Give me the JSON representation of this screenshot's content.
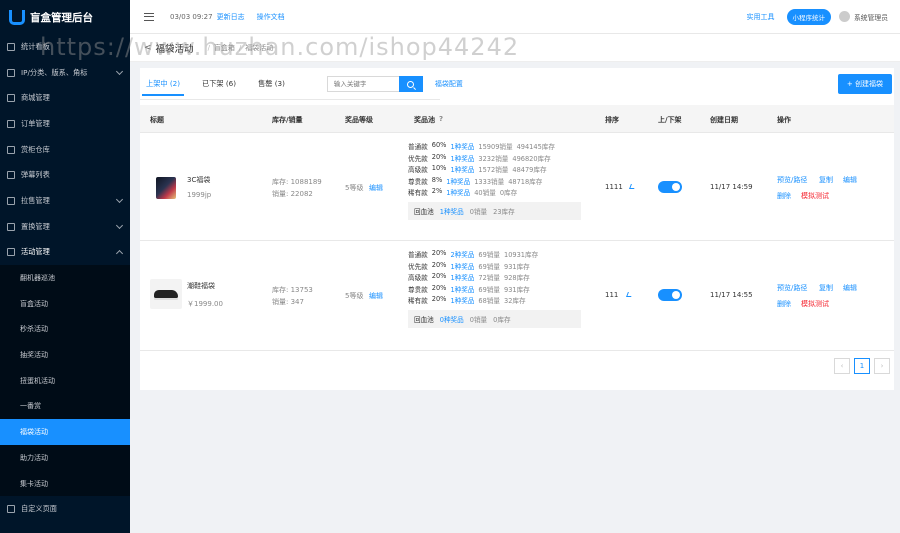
{
  "app": {
    "title": "盲盒管理后台"
  },
  "sidebar": {
    "items": [
      {
        "label": "统计看板",
        "chevron": false
      },
      {
        "label": "IP/分类、版系、角标",
        "chevron": true
      },
      {
        "label": "商城管理",
        "chevron": false
      },
      {
        "label": "订单管理",
        "chevron": false
      },
      {
        "label": "赏柜仓库",
        "chevron": false
      },
      {
        "label": "弹幕列表",
        "chevron": false
      },
      {
        "label": "拉售管理",
        "chevron": true
      },
      {
        "label": "置换管理",
        "chevron": true
      }
    ],
    "open_group": {
      "label": "活动管理"
    },
    "sub_items": [
      "翻机器巡池",
      "盲盒活动",
      "秒杀活动",
      "抽奖活动",
      "扭蛋机活动",
      "一番赏",
      "福袋活动",
      "助力活动",
      "集卡活动"
    ],
    "active_sub": "福袋活动",
    "footer_item": {
      "label": "自定义页面"
    }
  },
  "header": {
    "date": "03/03 09:27",
    "changelog": "更新日志",
    "docs": "操作文档",
    "tools": "实用工具",
    "mini_stats": "小程序统计",
    "user": "系统管理员"
  },
  "breadcrumb": {
    "title": "福袋活动",
    "items": [
      "盲盒箱",
      "福袋活动"
    ]
  },
  "watermark": "https://www.huzhan.com/ishop44242",
  "toolbar": {
    "tabs": [
      "上架中 (2)",
      "已下架 (6)",
      "售罄 (3)"
    ],
    "search_placeholder": "输入关键字",
    "config_link": "福袋配置",
    "create_label": "+ 创建福袋"
  },
  "table": {
    "headers": [
      "标题",
      "库存/销量",
      "奖品等级",
      "奖品池",
      "排序",
      "上/下架",
      "创建日期",
      "操作"
    ],
    "pool_help": "?",
    "rows": [
      {
        "title": "3C福袋",
        "price": "1999jp",
        "stock": "库存: 1088189",
        "sales": "销量: 22082",
        "level": "5等级",
        "level_edit": "编辑",
        "pool": [
          {
            "grade": "普通款",
            "pct": "60%",
            "prize": "1种奖品",
            "sold": "15909销量",
            "inv": "494145库存"
          },
          {
            "grade": "优先款",
            "pct": "20%",
            "prize": "1种奖品",
            "sold": "3232销量",
            "inv": "496820库存"
          },
          {
            "grade": "高级款",
            "pct": "10%",
            "prize": "1种奖品",
            "sold": "1572销量",
            "inv": "48479库存"
          },
          {
            "grade": "尊贵款",
            "pct": "8%",
            "prize": "1种奖品",
            "sold": "1333销量",
            "inv": "48718库存"
          },
          {
            "grade": "稀有款",
            "pct": "2%",
            "prize": "1种奖品",
            "sold": "40销量",
            "inv": "0库存"
          }
        ],
        "recycle": {
          "label": "回血池",
          "prize": "1种奖品",
          "sold": "0销量",
          "inv": "23库存"
        },
        "sort": "1111",
        "date": "11/17 14:59",
        "actions": [
          "预览/路径",
          "复制",
          "编辑",
          "删除",
          "模拟测试"
        ]
      },
      {
        "title": "潮鞋福袋",
        "price": "￥1999.00",
        "stock": "库存: 13753",
        "sales": "销量: 347",
        "level": "5等级",
        "level_edit": "编辑",
        "pool": [
          {
            "grade": "普通款",
            "pct": "20%",
            "prize": "2种奖品",
            "sold": "69销量",
            "inv": "10931库存"
          },
          {
            "grade": "优先款",
            "pct": "20%",
            "prize": "1种奖品",
            "sold": "69销量",
            "inv": "931库存"
          },
          {
            "grade": "高级款",
            "pct": "20%",
            "prize": "1种奖品",
            "sold": "72销量",
            "inv": "928库存"
          },
          {
            "grade": "尊贵款",
            "pct": "20%",
            "prize": "1种奖品",
            "sold": "69销量",
            "inv": "931库存"
          },
          {
            "grade": "稀有款",
            "pct": "20%",
            "prize": "1种奖品",
            "sold": "68销量",
            "inv": "32库存"
          }
        ],
        "recycle": {
          "label": "回血池",
          "prize": "0种奖品",
          "sold": "0销量",
          "inv": "0库存"
        },
        "sort": "111",
        "date": "11/17 14:55",
        "actions": [
          "预览/路径",
          "复制",
          "编辑",
          "删除",
          "模拟测试"
        ]
      }
    ]
  },
  "pagination": {
    "prev": "‹",
    "current": "1",
    "next": "›"
  },
  "colors": {
    "sidebar_bg": "#001529",
    "accent": "#1890ff",
    "danger": "#f5222d"
  }
}
